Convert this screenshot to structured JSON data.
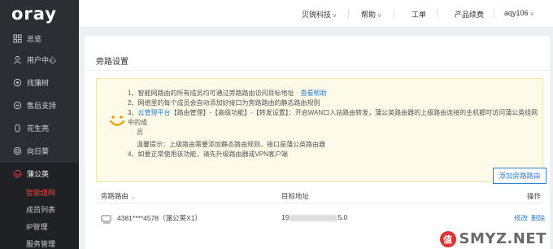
{
  "brand": {
    "logo_text": "oray"
  },
  "sidebar": {
    "items": [
      {
        "label": "总览",
        "icon": "grid-icon"
      },
      {
        "label": "用户中心",
        "icon": "user-icon"
      },
      {
        "label": "找蒲树",
        "icon": "tree-icon"
      },
      {
        "label": "售后支持",
        "icon": "support-icon"
      },
      {
        "label": "花生壳",
        "icon": "peanut-icon"
      },
      {
        "label": "向日葵",
        "icon": "sunflower-icon"
      },
      {
        "label": "蒲公英",
        "icon": "dandelion-icon"
      }
    ],
    "sub_items": [
      {
        "label": "智能组网",
        "active": true
      },
      {
        "label": "成员列表",
        "active": false
      },
      {
        "label": "IP管理",
        "active": false
      },
      {
        "label": "服务管理",
        "active": false
      }
    ]
  },
  "topbar": {
    "company": "贝锐科技",
    "help": "帮助",
    "ticket": "工单",
    "renew": "产品续费",
    "user": "aqy106"
  },
  "page": {
    "title": "旁路设置",
    "notice": {
      "line1": "1、智能网路由的所有成员均可通过旁路路由访问目标地址",
      "line1_link": "查看帮助",
      "line2": "2、网络里的每个成员会自动添加好接口为旁路路由的静态路由规则",
      "line3_a": "3、",
      "line3_link": "云管理平台",
      "line3_b": "【路由管理】-【高级功能】-【转发设置】：开启WAN口入站路由转发，蒲公英路由器的上级路由连接的主机都可访问蒲公英组网中的成",
      "line3_c": "员",
      "line3_tip": "温馨提示：上级路由需要添加静态路由规则，接口是蒲公英路由器",
      "line4": "4、如要正常使用该功能，请先升级路由器或VPN客户端"
    },
    "add_button": "添加旁路路由",
    "table": {
      "headers": [
        "旁路路由",
        "目标地址",
        "操作"
      ],
      "rows": [
        {
          "router": "4381****4578（蒲公英X1）",
          "target_prefix": "19",
          "target_suffix": "5.0",
          "edit": "修改",
          "delete": "删除"
        }
      ]
    }
  },
  "watermark": {
    "badge": "值",
    "text": "SMYZ.NET"
  },
  "colors": {
    "sidebar_bg": "#2b2e33",
    "accent_red": "#e8463b",
    "link_blue": "#2f80d1",
    "notice_bg": "#fefae8"
  }
}
